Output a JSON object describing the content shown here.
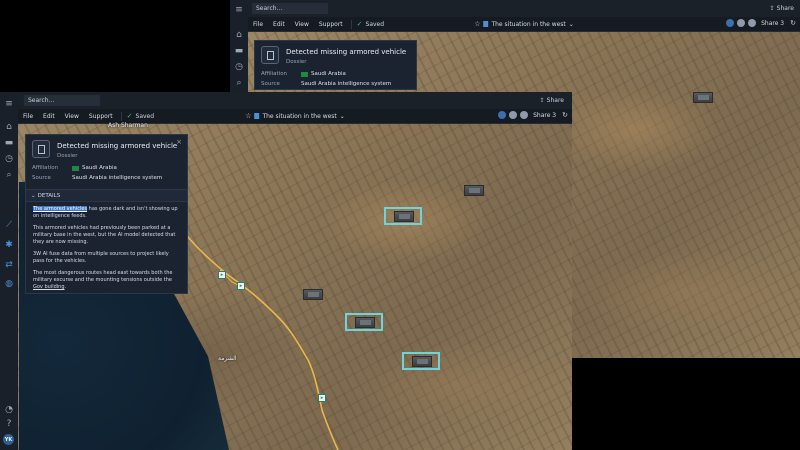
{
  "app": {
    "search_placeholder": "Search...",
    "share_label": "Share",
    "menu": [
      "File",
      "Edit",
      "View",
      "Support"
    ],
    "saved_label": "Saved",
    "document_title": "The situation in the west",
    "share_count_label": "Share 3",
    "user_initials": "YK"
  },
  "map": {
    "place_label_top": "Ash Sharman",
    "place_label_bottom": "الشرمة"
  },
  "dossier": {
    "title": "Detected missing armored vehicle",
    "subtitle": "Dossier",
    "affiliation_label": "Affiliation",
    "affiliation_value": "Saudi Arabia",
    "source_label": "Source",
    "source_value": "Saudi Arabia intelligence system",
    "details_label": "DETAILS",
    "p1_link": "The armored vehicles",
    "p1_rest": " has gone dark and isn't showing up on intelligence feeds.",
    "p2": "This armored vehicles had previously been parked at a military base in the west, but the AI model detected that they are now missing.",
    "p3": "3W AI fuse data from multiple sources to project likely pass for the vehicles.",
    "p4_text": "The most dangerous routes head east towards both the military excurse and the mounting tensions outside the ",
    "p4_link": "Gov building",
    "p4_end": "."
  },
  "colors": {
    "accent": "#4a8fd8",
    "highlight": "#6fd3d9",
    "saved_check": "#3fb37f",
    "road": "#e8b84a"
  }
}
